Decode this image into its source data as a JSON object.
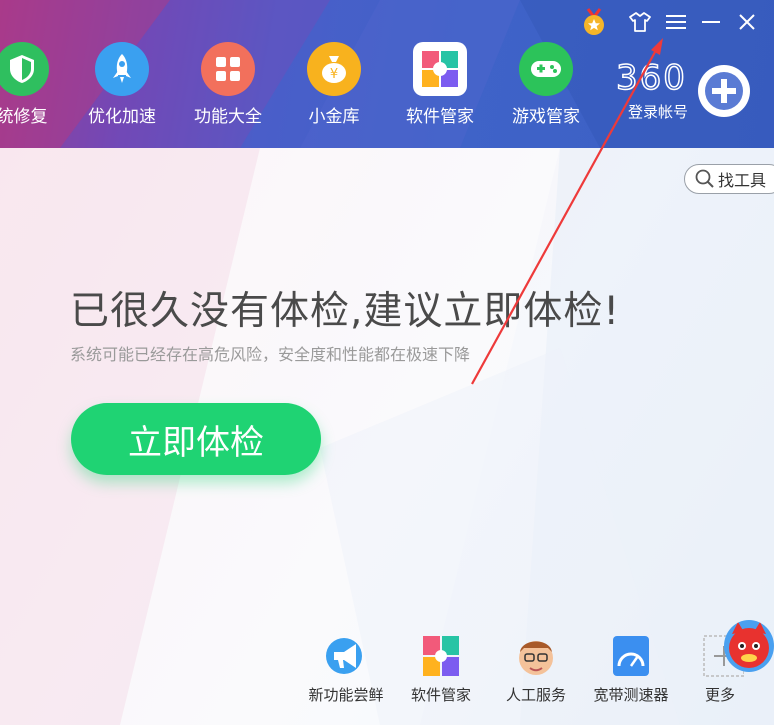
{
  "nav": {
    "items": [
      {
        "label": "统修复"
      },
      {
        "label": "优化加速"
      },
      {
        "label": "功能大全"
      },
      {
        "label": "小金库"
      },
      {
        "label": "软件管家"
      },
      {
        "label": "游戏管家"
      }
    ],
    "logo_text": "360",
    "login_label": "登录帐号"
  },
  "toolbar": {
    "find_tool_label": "找工具"
  },
  "main": {
    "headline": "已很久没有体检,建议立即体检!",
    "subline": "系统可能已经存在高危风险，安全度和性能都在极速下降",
    "check_button": "立即体检"
  },
  "bottom": {
    "items": [
      {
        "label": "新功能尝鲜"
      },
      {
        "label": "软件管家"
      },
      {
        "label": "人工服务"
      },
      {
        "label": "宽带测速器"
      },
      {
        "label": "更多"
      }
    ]
  },
  "colors": {
    "accent_green": "#1fd373",
    "header_blue": "#3f63c8"
  }
}
